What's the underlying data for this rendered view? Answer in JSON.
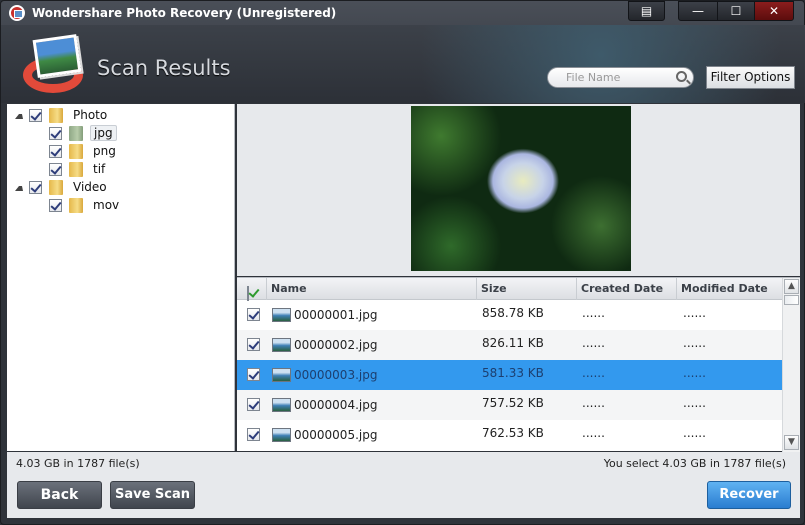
{
  "window": {
    "title": "Wondershare Photo Recovery (Unregistered)",
    "controls": {
      "menu": "menu-icon",
      "minimize": "—",
      "maximize": "☐",
      "close": "✕"
    }
  },
  "header": {
    "page_title": "Scan Results",
    "search": {
      "placeholder": "File Name",
      "value": ""
    },
    "filter_label": "Filter Options"
  },
  "tree": [
    {
      "label": "Photo",
      "checked": true,
      "expanded": true,
      "level": 0
    },
    {
      "label": "jpg",
      "checked": true,
      "level": 1,
      "selected": true
    },
    {
      "label": "png",
      "checked": true,
      "level": 1
    },
    {
      "label": "tif",
      "checked": true,
      "level": 1
    },
    {
      "label": "Video",
      "checked": true,
      "expanded": true,
      "level": 0
    },
    {
      "label": "mov",
      "checked": true,
      "level": 1
    }
  ],
  "grid": {
    "columns": {
      "name": "Name",
      "size": "Size",
      "created": "Created Date",
      "modified": "Modified Date"
    },
    "rows": [
      {
        "name": "00000001.jpg",
        "size": "858.78 KB",
        "created": "......",
        "modified": "......",
        "checked": true
      },
      {
        "name": "00000002.jpg",
        "size": "826.11 KB",
        "created": "......",
        "modified": "......",
        "checked": true
      },
      {
        "name": "00000003.jpg",
        "size": "581.33 KB",
        "created": "......",
        "modified": "......",
        "checked": true,
        "selected": true
      },
      {
        "name": "00000004.jpg",
        "size": "757.52 KB",
        "created": "......",
        "modified": "......",
        "checked": true
      },
      {
        "name": "00000005.jpg",
        "size": "762.53 KB",
        "created": "......",
        "modified": "......",
        "checked": true
      }
    ]
  },
  "status": {
    "total": "4.03 GB in 1787 file(s)",
    "selected": "You select 4.03 GB in 1787 file(s)"
  },
  "buttons": {
    "back": "Back",
    "save_scan": "Save Scan",
    "recover": "Recover"
  }
}
